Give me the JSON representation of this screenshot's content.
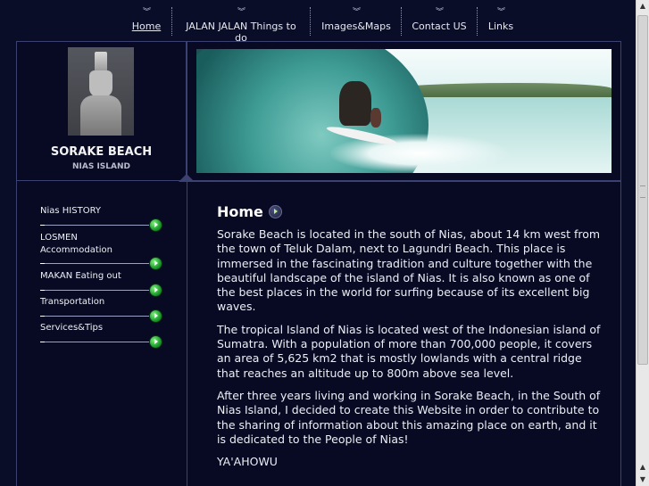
{
  "nav": {
    "items": [
      {
        "label": "Home",
        "active": true
      },
      {
        "label": "JALAN JALAN Things to do"
      },
      {
        "label": "Images&Maps"
      },
      {
        "label": "Contact US"
      },
      {
        "label": "Links"
      }
    ],
    "chevron": "︾"
  },
  "site": {
    "title": "SORAKE BEACH",
    "subtitle": "NIAS ISLAND"
  },
  "sidebar": {
    "items": [
      {
        "line1": "Nias HISTORY",
        "line2": ""
      },
      {
        "line1": "LOSMEN",
        "line2": "Accommodation"
      },
      {
        "line1": "MAKAN Eating out",
        "line2": ""
      },
      {
        "line1": "Transportation",
        "line2": ""
      },
      {
        "line1": "Services&Tips",
        "line2": ""
      }
    ]
  },
  "content": {
    "heading": "Home",
    "paragraphs": [
      "Sorake Beach is located in the south of Nias, about 14 km west from the town of Teluk Dalam, next to Lagundri Beach. This place is immersed in the fascinating tradition and culture together with the beautiful landscape of the island of Nias. It is also known as one of the best places in the world for surfing because of its excellent big waves.",
      "The tropical Island of Nias is located west of the Indonesian island of Sumatra. With a population of more than 700,000 people, it covers an area of 5,625 km2 that is mostly lowlands with a central ridge that reaches an altitude up to 800m above sea level.",
      "After three years living and working in Sorake Beach, in the South of Nias Island, I decided to create this Website in order to contribute to the sharing of information about this amazing place on earth, and it is dedicated to the People of Nias!",
      "YA'AHOWU"
    ]
  },
  "colors": {
    "background": "#0a0d28",
    "border": "#3b4170",
    "accent_green": "#1c9a2b"
  }
}
